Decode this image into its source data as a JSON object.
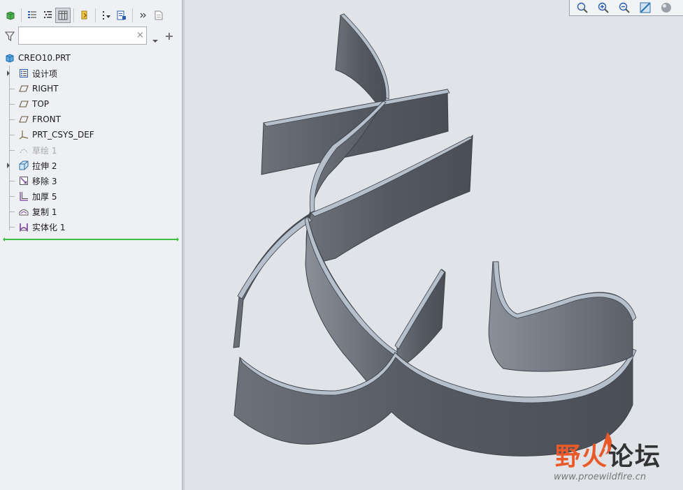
{
  "filter": {
    "value": "",
    "clear_label": "×"
  },
  "tree": {
    "root": "CREO10.PRT",
    "items": [
      {
        "label": "设计项",
        "icon": "design-items-icon",
        "expandable": true,
        "dim": false
      },
      {
        "label": "RIGHT",
        "icon": "datum-plane-icon",
        "expandable": false,
        "dim": false
      },
      {
        "label": "TOP",
        "icon": "datum-plane-icon",
        "expandable": false,
        "dim": false
      },
      {
        "label": "FRONT",
        "icon": "datum-plane-icon",
        "expandable": false,
        "dim": false
      },
      {
        "label": "PRT_CSYS_DEF",
        "icon": "csys-icon",
        "expandable": false,
        "dim": false
      },
      {
        "label": "草绘 1",
        "icon": "sketch-icon",
        "expandable": false,
        "dim": true
      },
      {
        "label": "拉伸 2",
        "icon": "extrude-icon",
        "expandable": true,
        "dim": false
      },
      {
        "label": "移除 3",
        "icon": "remove-icon",
        "expandable": false,
        "dim": false
      },
      {
        "label": "加厚 5",
        "icon": "thicken-icon",
        "expandable": false,
        "dim": false
      },
      {
        "label": "复制 1",
        "icon": "copy-icon",
        "expandable": false,
        "dim": false
      },
      {
        "label": "实体化 1",
        "icon": "solidify-icon",
        "expandable": false,
        "dim": false
      }
    ]
  },
  "watermark": {
    "title_red": "野火",
    "title_dark": "论坛",
    "url": "www.proewildfire.cn"
  },
  "colors": {
    "model_side": "#5a5e66",
    "model_top": "#b6c0cc",
    "accent": "#3fbf3f",
    "watermark_red": "#e85a2a"
  }
}
